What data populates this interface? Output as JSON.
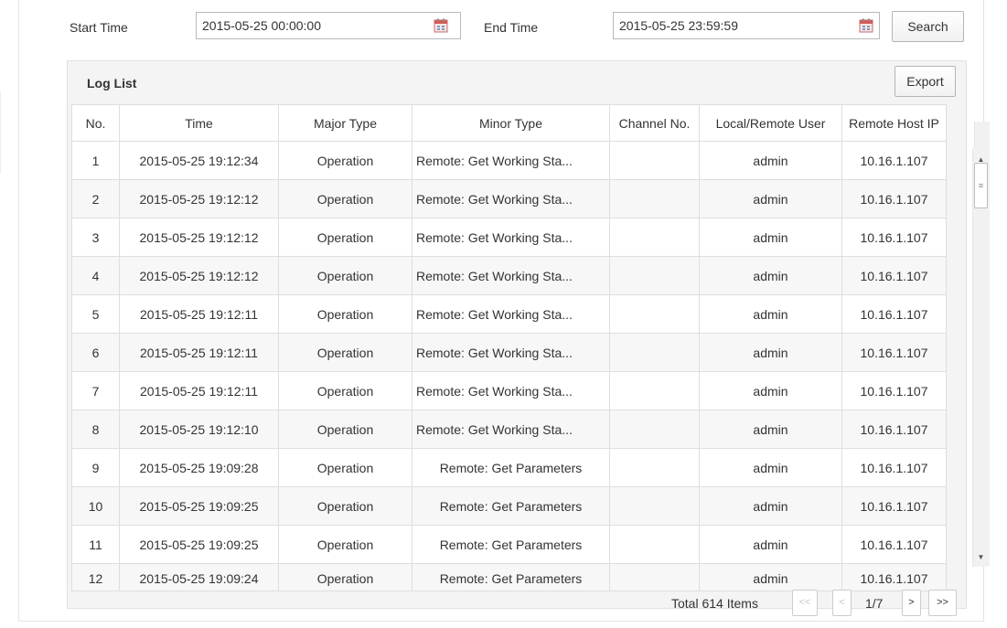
{
  "search": {
    "start_label": "Start Time",
    "start_value": "2015-05-25 00:00:00",
    "end_label": "End Time",
    "end_value": "2015-05-25 23:59:59",
    "search_label": "Search"
  },
  "log_list": {
    "title": "Log List",
    "export_label": "Export",
    "columns": [
      "No.",
      "Time",
      "Major Type",
      "Minor Type",
      "Channel No.",
      "Local/Remote User",
      "Remote Host IP"
    ],
    "rows": [
      {
        "no": "1",
        "time": "2015-05-25 19:12:34",
        "major": "Operation",
        "minor": "Remote: Get Working Sta...",
        "channel": "",
        "user": "admin",
        "ip": "10.16.1.107"
      },
      {
        "no": "2",
        "time": "2015-05-25 19:12:12",
        "major": "Operation",
        "minor": "Remote: Get Working Sta...",
        "channel": "",
        "user": "admin",
        "ip": "10.16.1.107"
      },
      {
        "no": "3",
        "time": "2015-05-25 19:12:12",
        "major": "Operation",
        "minor": "Remote: Get Working Sta...",
        "channel": "",
        "user": "admin",
        "ip": "10.16.1.107"
      },
      {
        "no": "4",
        "time": "2015-05-25 19:12:12",
        "major": "Operation",
        "minor": "Remote: Get Working Sta...",
        "channel": "",
        "user": "admin",
        "ip": "10.16.1.107"
      },
      {
        "no": "5",
        "time": "2015-05-25 19:12:11",
        "major": "Operation",
        "minor": "Remote: Get Working Sta...",
        "channel": "",
        "user": "admin",
        "ip": "10.16.1.107"
      },
      {
        "no": "6",
        "time": "2015-05-25 19:12:11",
        "major": "Operation",
        "minor": "Remote: Get Working Sta...",
        "channel": "",
        "user": "admin",
        "ip": "10.16.1.107"
      },
      {
        "no": "7",
        "time": "2015-05-25 19:12:11",
        "major": "Operation",
        "minor": "Remote: Get Working Sta...",
        "channel": "",
        "user": "admin",
        "ip": "10.16.1.107"
      },
      {
        "no": "8",
        "time": "2015-05-25 19:12:10",
        "major": "Operation",
        "minor": "Remote: Get Working Sta...",
        "channel": "",
        "user": "admin",
        "ip": "10.16.1.107"
      },
      {
        "no": "9",
        "time": "2015-05-25 19:09:28",
        "major": "Operation",
        "minor": "Remote: Get Parameters",
        "channel": "",
        "user": "admin",
        "ip": "10.16.1.107"
      },
      {
        "no": "10",
        "time": "2015-05-25 19:09:25",
        "major": "Operation",
        "minor": "Remote: Get Parameters",
        "channel": "",
        "user": "admin",
        "ip": "10.16.1.107"
      },
      {
        "no": "11",
        "time": "2015-05-25 19:09:25",
        "major": "Operation",
        "minor": "Remote: Get Parameters",
        "channel": "",
        "user": "admin",
        "ip": "10.16.1.107"
      },
      {
        "no": "12",
        "time": "2015-05-25 19:09:24",
        "major": "Operation",
        "minor": "Remote: Get Parameters",
        "channel": "",
        "user": "admin",
        "ip": "10.16.1.107"
      }
    ]
  },
  "pagination": {
    "total_text": "Total 614 Items",
    "first_label": "<<",
    "prev_label": "<",
    "page_text": "1/7",
    "next_label": ">",
    "last_label": ">>"
  },
  "icons": {
    "calendar": "calendar-icon",
    "scroll_up": "scroll-up-arrow-icon",
    "scroll_down": "scroll-down-arrow-icon"
  },
  "colors": {
    "panel_bg": "#f4f4f4",
    "border": "#dedede",
    "text": "#333333"
  }
}
